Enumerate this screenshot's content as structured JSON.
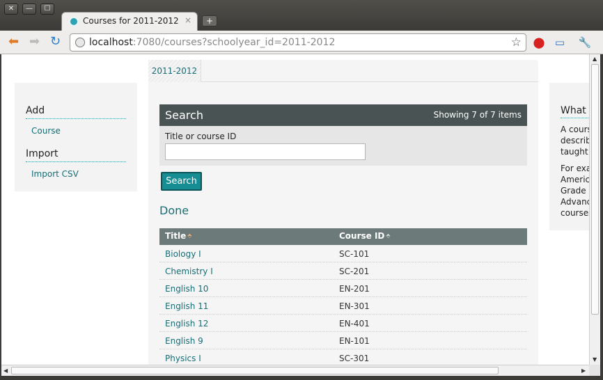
{
  "window": {
    "buttons": [
      "✕",
      "—",
      "☐"
    ]
  },
  "tab": {
    "title": "Courses for 2011-2012",
    "close": "×",
    "new_tab": "+"
  },
  "address": {
    "host": "localhost",
    "path": ":7080/courses?schoolyear_id=2011-2012"
  },
  "sidebar": {
    "sections": [
      {
        "heading": "Add",
        "links": [
          "Course"
        ]
      },
      {
        "heading": "Import",
        "links": [
          "Import CSV"
        ]
      }
    ]
  },
  "main": {
    "tab_label": "2011-2012",
    "search": {
      "title": "Search",
      "count_text": "Showing 7 of 7 items",
      "field_label": "Title or course ID",
      "field_value": "",
      "button_label": "Search"
    },
    "done_label": "Done",
    "table": {
      "columns": [
        "Title",
        "Course ID"
      ],
      "rows": [
        {
          "title": "Biology I",
          "course_id": "SC-101"
        },
        {
          "title": "Chemistry I",
          "course_id": "SC-201"
        },
        {
          "title": "English 10",
          "course_id": "EN-201"
        },
        {
          "title": "English 11",
          "course_id": "EN-301"
        },
        {
          "title": "English 12",
          "course_id": "EN-401"
        },
        {
          "title": "English 9",
          "course_id": "EN-101"
        },
        {
          "title": "Physics I",
          "course_id": "SC-301"
        }
      ]
    }
  },
  "right_column": {
    "heading": "What i",
    "paragraph1": "A cours\ndescribe\ntaught",
    "paragraph2": "For exa\nAmerica\nGrade R\nAdvanc\ncourses"
  }
}
